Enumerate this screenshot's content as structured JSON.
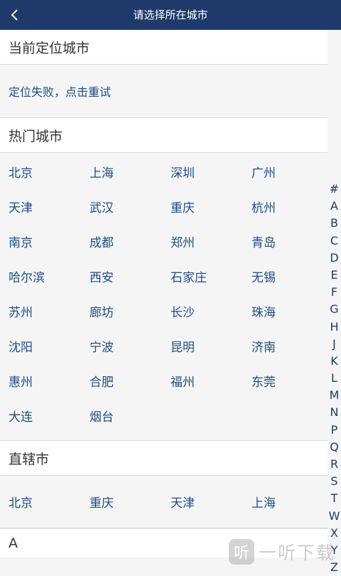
{
  "header": {
    "title": "请选择所在城市",
    "back_icon": "chevron-left-icon"
  },
  "current_location": {
    "title": "当前定位城市",
    "status": "定位失败，点击重试"
  },
  "hot_cities": {
    "title": "热门城市",
    "cities": [
      "北京",
      "上海",
      "深圳",
      "广州",
      "天津",
      "武汉",
      "重庆",
      "杭州",
      "南京",
      "成都",
      "郑州",
      "青岛",
      "哈尔滨",
      "西安",
      "石家庄",
      "无锡",
      "苏州",
      "廊坊",
      "长沙",
      "珠海",
      "沈阳",
      "宁波",
      "昆明",
      "济南",
      "惠州",
      "合肥",
      "福州",
      "东莞",
      "大连",
      "烟台"
    ]
  },
  "municipalities": {
    "title": "直辖市",
    "cities": [
      "北京",
      "重庆",
      "天津",
      "上海"
    ]
  },
  "letter_section": {
    "title": "A"
  },
  "index_bar": [
    "#",
    "A",
    "B",
    "C",
    "D",
    "E",
    "F",
    "G",
    "H",
    "J",
    "K",
    "L",
    "M",
    "N",
    "P",
    "Q",
    "R",
    "S",
    "T",
    "W",
    "X",
    "Y",
    "Z"
  ],
  "watermark": {
    "logo": "听",
    "text": "一听下载"
  },
  "colors": {
    "header_bg": "#1f3a6a",
    "city_text": "#1f4c82",
    "page_bg": "#f5f5f5"
  }
}
